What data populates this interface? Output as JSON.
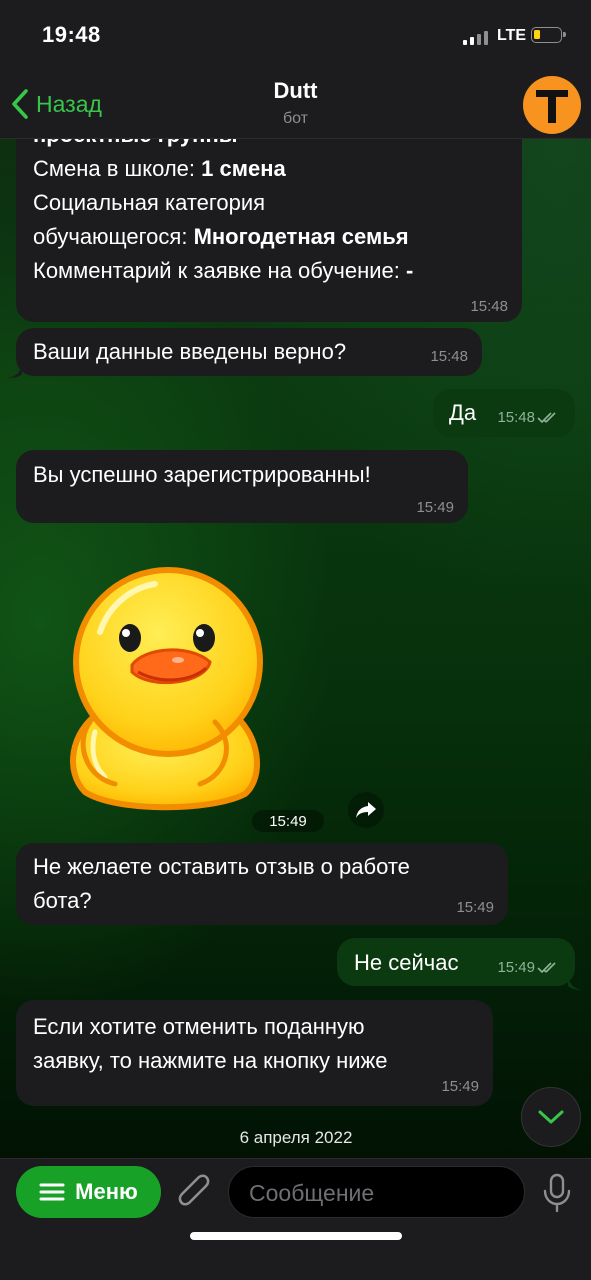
{
  "status_bar": {
    "time": "19:48",
    "network": "LTE"
  },
  "header": {
    "back_label": "Назад",
    "title": "Dutt",
    "subtitle": "бот",
    "avatar_letter": "T",
    "avatar_color": "#f7931e"
  },
  "messages": {
    "m1": {
      "cut_line": "проектные группы",
      "line1_key": "Смена в школе: ",
      "line1_val": "1 смена",
      "line2": "Социальная категория",
      "line3_key": "обучающегося: ",
      "line3_val": "Многодетная семья",
      "line4_key": "Комментарий к заявке на обучение: ",
      "line4_val": "-",
      "time": "15:48"
    },
    "m2": {
      "text": "Ваши данные введены верно?",
      "time": "15:48"
    },
    "m3": {
      "text": "Да",
      "time": "15:48"
    },
    "m4": {
      "text": "Вы успешно зарегистрированны!",
      "time": "15:49"
    },
    "sticker": {
      "time": "15:49",
      "icon": "duck-sticker"
    },
    "m5": {
      "line1": "Не желаете оставить отзыв о работе",
      "line2": "бота?",
      "time": "15:49"
    },
    "m6": {
      "text": "Не сейчас",
      "time": "15:49"
    },
    "m7": {
      "line1": "Если хотите отменить поданную",
      "line2": "заявку, то нажмите на кнопку ниже",
      "time": "15:49"
    }
  },
  "date_separator": "6 апреля 2022",
  "input_bar": {
    "menu_label": "Меню",
    "placeholder": "Сообщение"
  },
  "colors": {
    "accent": "#37c64a",
    "menu_button": "#17a227",
    "incoming_bubble": "#1c1c1e",
    "outgoing_bubble": "#0b3a10"
  }
}
